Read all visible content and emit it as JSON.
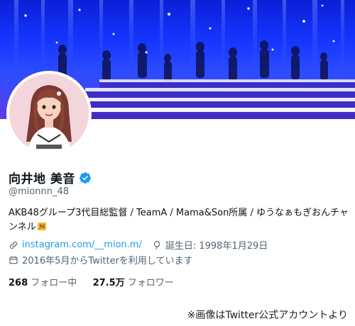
{
  "profile": {
    "display_name": "向井地 美音",
    "handle": "@mionnn_48",
    "bio": "AKB48グループ3代目総監督 / TeamA / Mama&Son所属 / ゆうなぁもぎおんチャンネル",
    "link_text": "instagram.com/__mion.m/",
    "birthday": "誕生日: 1998年1月29日",
    "joined": "2016年5月からTwitterを利用しています",
    "following_count": "268",
    "following_label": "フォロー中",
    "followers_count": "27.5万",
    "followers_label": "フォロワー"
  },
  "caption": "※画像はTwitter公式アカウントより",
  "colors": {
    "accent": "#1d9bf0",
    "banner_blue": "#1636ff",
    "secondary_text": "#536471"
  },
  "icons": [
    "verified-badge-icon",
    "link-icon",
    "birthday-balloon-icon",
    "calendar-icon",
    "emoji-icon"
  ]
}
